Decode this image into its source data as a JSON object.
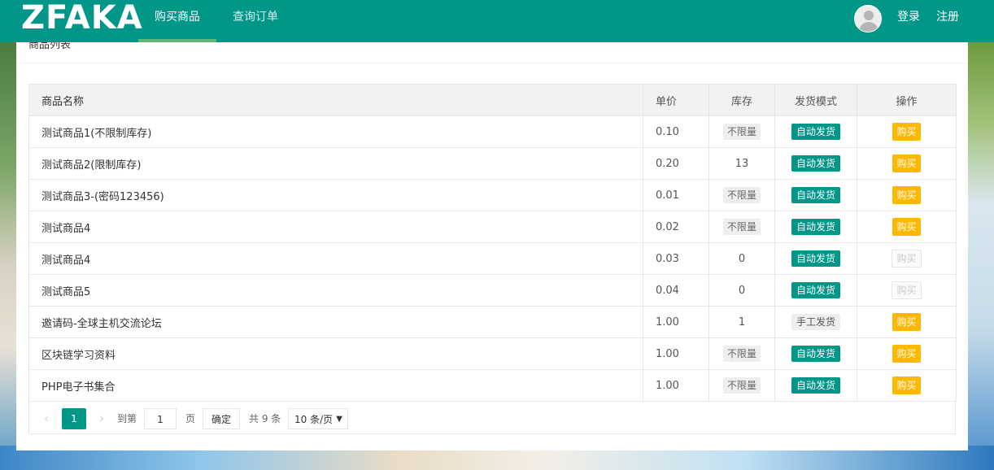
{
  "header": {
    "logo": "ZFAKA",
    "nav": [
      "购买商品",
      "查询订单"
    ],
    "login": "登录",
    "register": "注册"
  },
  "card": {
    "title": "商品列表"
  },
  "table": {
    "columns": [
      "商品名称",
      "单价",
      "库存",
      "发货模式",
      "操作"
    ],
    "rows": [
      {
        "name": "测试商品1(不限制库存)",
        "price": "0.10",
        "stock": "不限量",
        "mode": "自动发货",
        "action": "购买",
        "available": true
      },
      {
        "name": "测试商品2(限制库存)",
        "price": "0.20",
        "stock": "13",
        "mode": "自动发货",
        "action": "购买",
        "available": true
      },
      {
        "name": "测试商品3-(密码123456)",
        "price": "0.01",
        "stock": "不限量",
        "mode": "自动发货",
        "action": "购买",
        "available": true
      },
      {
        "name": "测试商品4",
        "price": "0.02",
        "stock": "不限量",
        "mode": "自动发货",
        "action": "购买",
        "available": true
      },
      {
        "name": "测试商品4",
        "price": "0.03",
        "stock": "0",
        "mode": "自动发货",
        "action": "购买",
        "available": false
      },
      {
        "name": "测试商品5",
        "price": "0.04",
        "stock": "0",
        "mode": "自动发货",
        "action": "购买",
        "available": false
      },
      {
        "name": "邀请码-全球主机交流论坛",
        "price": "1.00",
        "stock": "1",
        "mode": "手工发货",
        "action": "购买",
        "available": true
      },
      {
        "name": "区块链学习资料",
        "price": "1.00",
        "stock": "不限量",
        "mode": "自动发货",
        "action": "购买",
        "available": true
      },
      {
        "name": "PHP电子书集合",
        "price": "1.00",
        "stock": "不限量",
        "mode": "自动发货",
        "action": "购买",
        "available": true
      }
    ]
  },
  "pager": {
    "prev_icon": "chevron-left-icon",
    "next_icon": "chevron-right-icon",
    "current_page": "1",
    "goto_label": "到第",
    "goto_value": "1",
    "page_label": "页",
    "confirm": "确定",
    "total": "共 9 条",
    "page_size": "10 条/页"
  },
  "colors": {
    "primary": "#009688",
    "buy": "#ffb800",
    "active_underline": "#5fb878"
  }
}
